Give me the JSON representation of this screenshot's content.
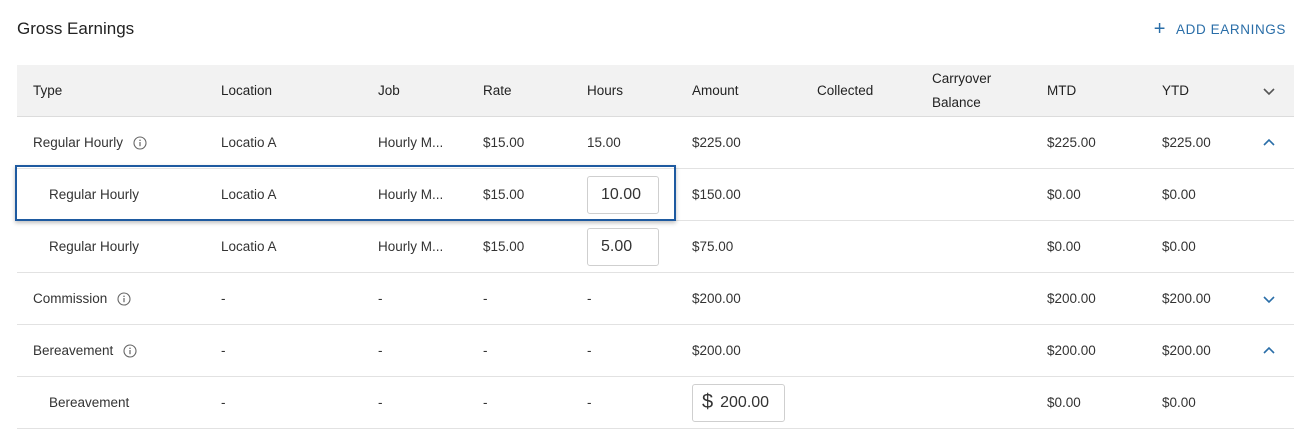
{
  "header": {
    "title": "Gross Earnings",
    "add_label": "ADD EARNINGS"
  },
  "columns": {
    "type": "Type",
    "location": "Location",
    "job": "Job",
    "rate": "Rate",
    "hours": "Hours",
    "amount": "Amount",
    "collected": "Collected",
    "carryover_1": "Carryover",
    "carryover_2": "Balance",
    "mtd": "MTD",
    "ytd": "YTD"
  },
  "rows": [
    {
      "type": "Regular Hourly",
      "location": "Locatio A",
      "job": "Hourly M...",
      "rate": "$15.00",
      "hours": "15.00",
      "amount": "$225.00",
      "mtd": "$225.00",
      "ytd": "$225.00"
    },
    {
      "type": "Regular Hourly",
      "location": "Locatio A",
      "job": "Hourly M...",
      "rate": "$15.00",
      "hours": "10.00",
      "amount": "$150.00",
      "mtd": "$0.00",
      "ytd": "$0.00"
    },
    {
      "type": "Regular Hourly",
      "location": "Locatio A",
      "job": "Hourly M...",
      "rate": "$15.00",
      "hours": "5.00",
      "amount": "$75.00",
      "mtd": "$0.00",
      "ytd": "$0.00"
    },
    {
      "type": "Commission",
      "location": "-",
      "job": "-",
      "rate": "-",
      "hours": "-",
      "amount": "$200.00",
      "mtd": "$200.00",
      "ytd": "$200.00"
    },
    {
      "type": "Bereavement",
      "location": "-",
      "job": "-",
      "rate": "-",
      "hours": "-",
      "amount": "$200.00",
      "mtd": "$200.00",
      "ytd": "$200.00"
    },
    {
      "type": "Bereavement",
      "location": "-",
      "job": "-",
      "rate": "-",
      "hours": "-",
      "currency": "$",
      "amount": "200.00",
      "mtd": "$0.00",
      "ytd": "$0.00"
    }
  ],
  "icons": {
    "info": "info-icon",
    "expand": "chevron-down-icon",
    "collapse": "chevron-up-icon",
    "add": "plus-icon"
  },
  "colors": {
    "accent": "#2a6ea8",
    "highlight": "#1e5aa0",
    "header_bg": "#f2f2f2"
  }
}
